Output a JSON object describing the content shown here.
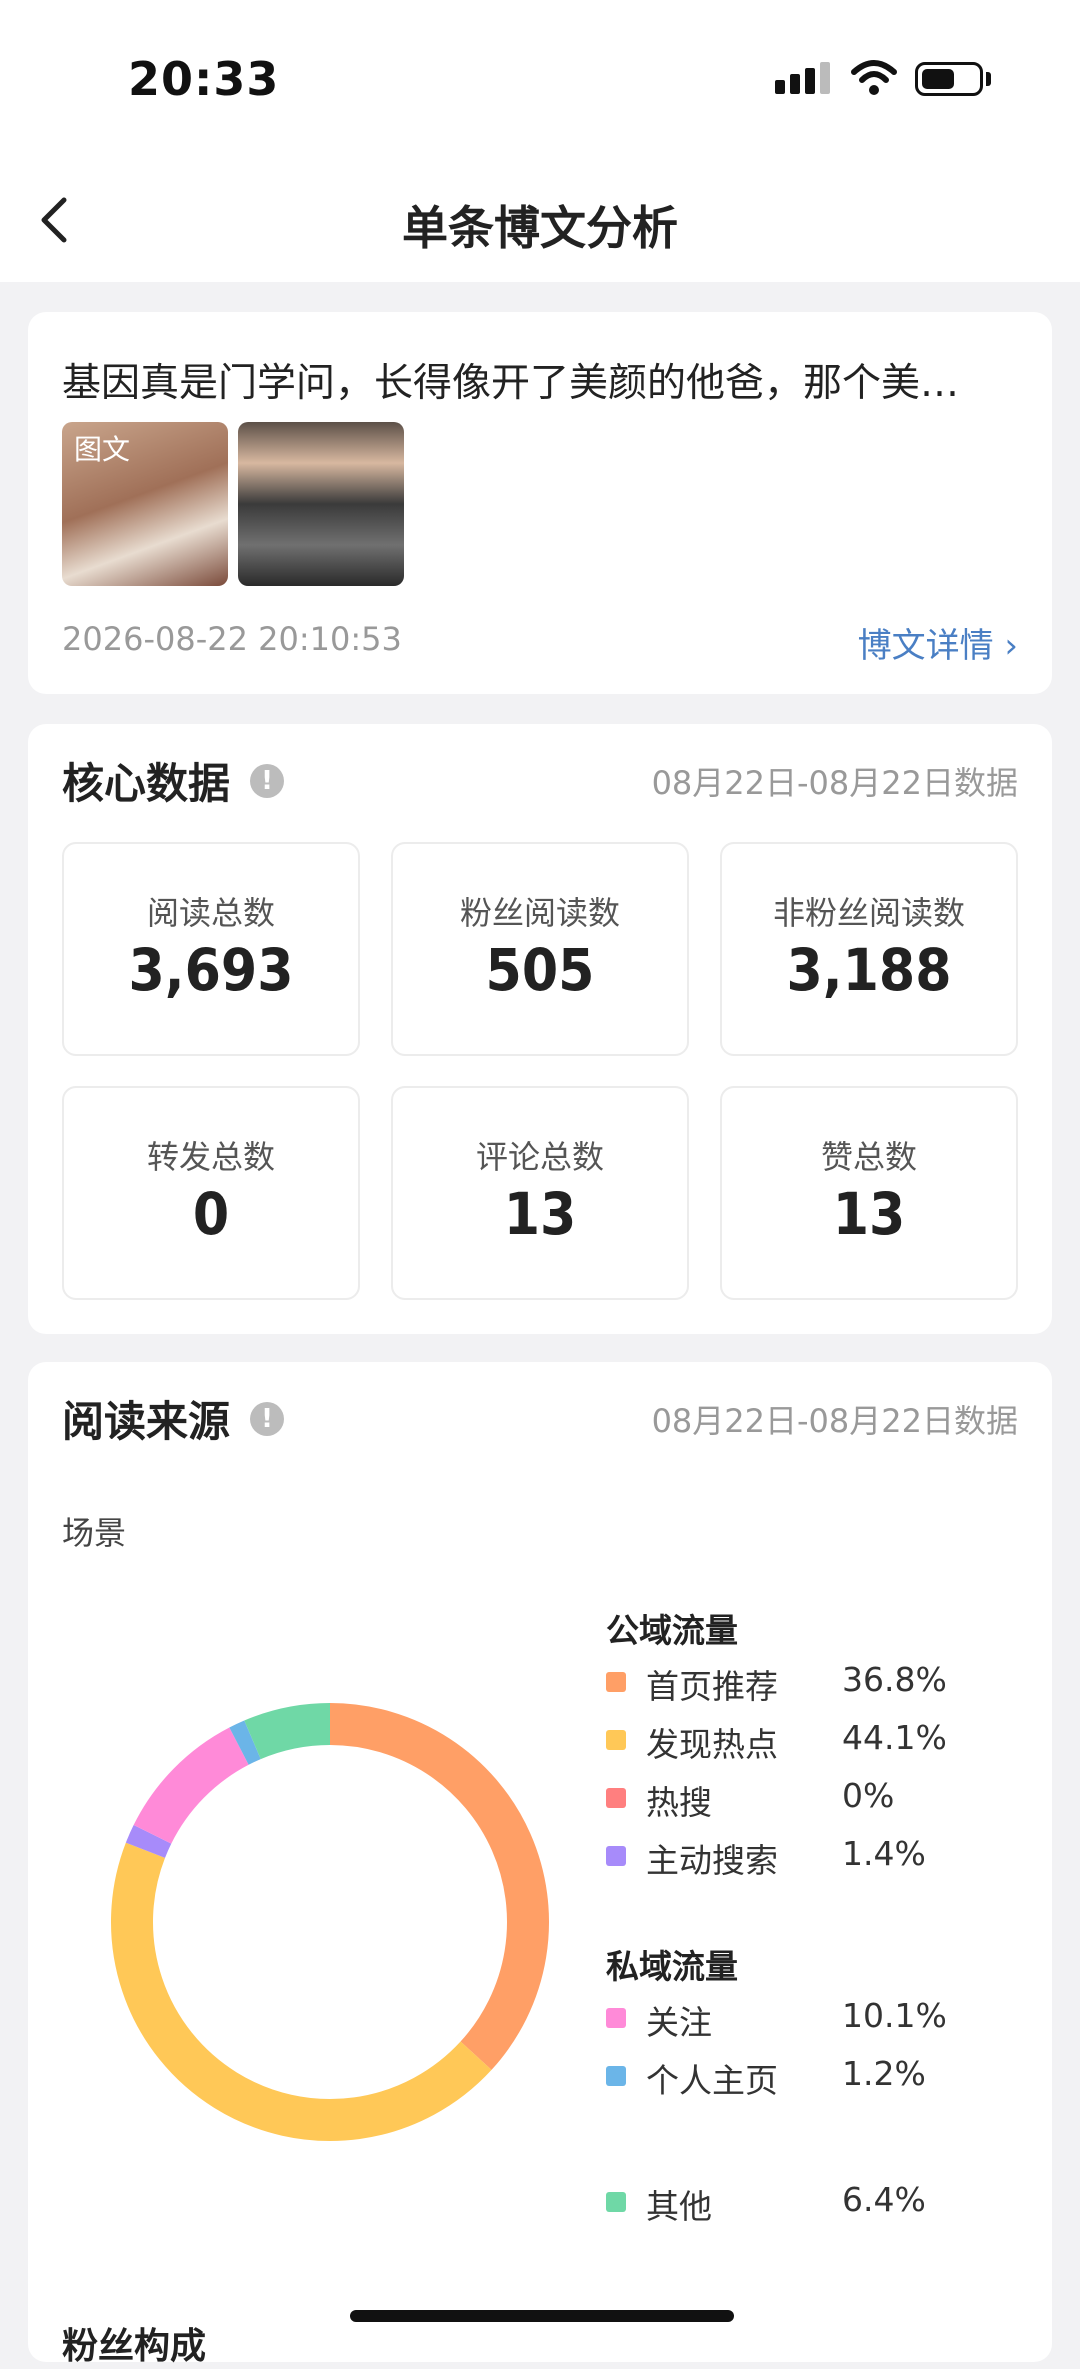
{
  "status": {
    "time": "20:33"
  },
  "nav": {
    "title": "单条博文分析"
  },
  "post": {
    "text": "基因真是门学问，长得像开了美颜的他爸，那个美…",
    "thumb_tag": "图文",
    "datetime": "2026-08-22 20:10:53",
    "detail_link": "博文详情 ›"
  },
  "core": {
    "title": "核心数据",
    "info": "!",
    "range": "08月22日-08月22日数据",
    "stats": [
      {
        "label": "阅读总数",
        "value": "3,693"
      },
      {
        "label": "粉丝阅读数",
        "value": "505"
      },
      {
        "label": "非粉丝阅读数",
        "value": "3,188"
      },
      {
        "label": "转发总数",
        "value": "0"
      },
      {
        "label": "评论总数",
        "value": "13"
      },
      {
        "label": "赞总数",
        "value": "13"
      }
    ]
  },
  "source": {
    "title": "阅读来源",
    "info": "!",
    "range": "08月22日-08月22日数据",
    "scene_label": "场景",
    "public_label": "公域流量",
    "private_label": "私域流量",
    "next_section_title": "粉丝构成"
  },
  "chart_data": {
    "type": "pie",
    "donut": true,
    "categories": [
      "首页推荐",
      "发现热点",
      "热搜",
      "主动搜索",
      "关注",
      "个人主页",
      "其他"
    ],
    "values": [
      36.8,
      44.1,
      0,
      1.4,
      10.1,
      1.2,
      6.4
    ],
    "value_labels": [
      "36.8%",
      "44.1%",
      "0%",
      "1.4%",
      "10.1%",
      "1.2%",
      "6.4%"
    ],
    "colors": [
      "#ff9f66",
      "#ffc857",
      "#ff7f7f",
      "#a78bfa",
      "#ff8ad8",
      "#6bb5e8",
      "#6fd8a6"
    ],
    "groups": [
      {
        "name": "公域流量",
        "items": [
          0,
          1,
          2,
          3
        ]
      },
      {
        "name": "私域流量",
        "items": [
          4,
          5
        ]
      },
      {
        "name": "",
        "items": [
          6
        ]
      }
    ]
  }
}
